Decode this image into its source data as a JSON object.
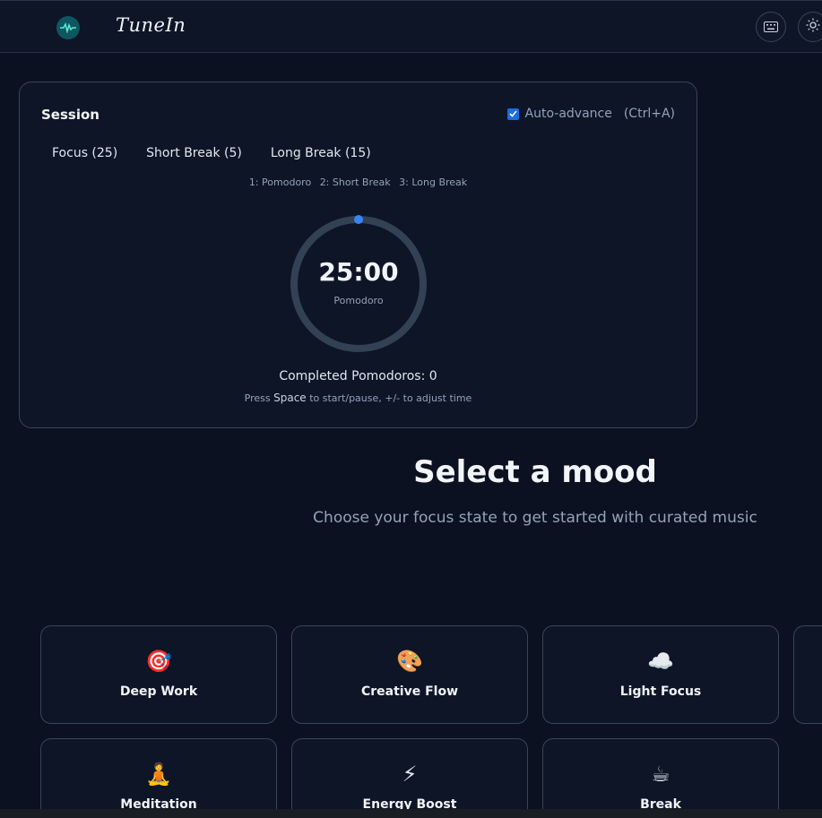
{
  "header": {
    "brand": "TuneIn",
    "logo_icon": "waveform-icon",
    "keyboard_icon": "keyboard-icon",
    "theme_icon": "sun-icon"
  },
  "session": {
    "title": "Session",
    "auto_advance_label": "Auto-advance",
    "auto_advance_checked": true,
    "auto_advance_shortcut": "(Ctrl+A)",
    "tabs": [
      {
        "label": "Focus (25)"
      },
      {
        "label": "Short Break (5)"
      },
      {
        "label": "Long Break (15)"
      }
    ],
    "hints": [
      "1: Pomodoro",
      "2: Short Break",
      "3: Long Break"
    ],
    "timer": {
      "time": "25:00",
      "label": "Pomodoro",
      "progress": 0
    },
    "completed_text": "Completed Pomodoros: 0",
    "press_prefix": "Press",
    "press_key": "Space",
    "press_suffix": "to start/pause, +/- to adjust time"
  },
  "mood": {
    "title": "Select a mood",
    "subtitle": "Choose your focus state to get started with curated music",
    "cards": [
      {
        "emoji": "🎯",
        "icon": "target-icon",
        "label": "Deep Work"
      },
      {
        "emoji": "🎨",
        "icon": "palette-icon",
        "label": "Creative Flow"
      },
      {
        "emoji": "☁️",
        "icon": "cloud-icon",
        "label": "Light Focus"
      },
      {
        "emoji": "🧘",
        "icon": "meditation-icon",
        "label": "Meditation"
      },
      {
        "emoji": "⚡",
        "icon": "lightning-icon",
        "label": "Energy Boost"
      },
      {
        "emoji": "☕",
        "icon": "coffee-icon",
        "label": "Break"
      }
    ]
  },
  "colors": {
    "background": "#0b1120",
    "card": "#0d1527",
    "accent": "#3b82f6",
    "ring_track": "#334155"
  }
}
